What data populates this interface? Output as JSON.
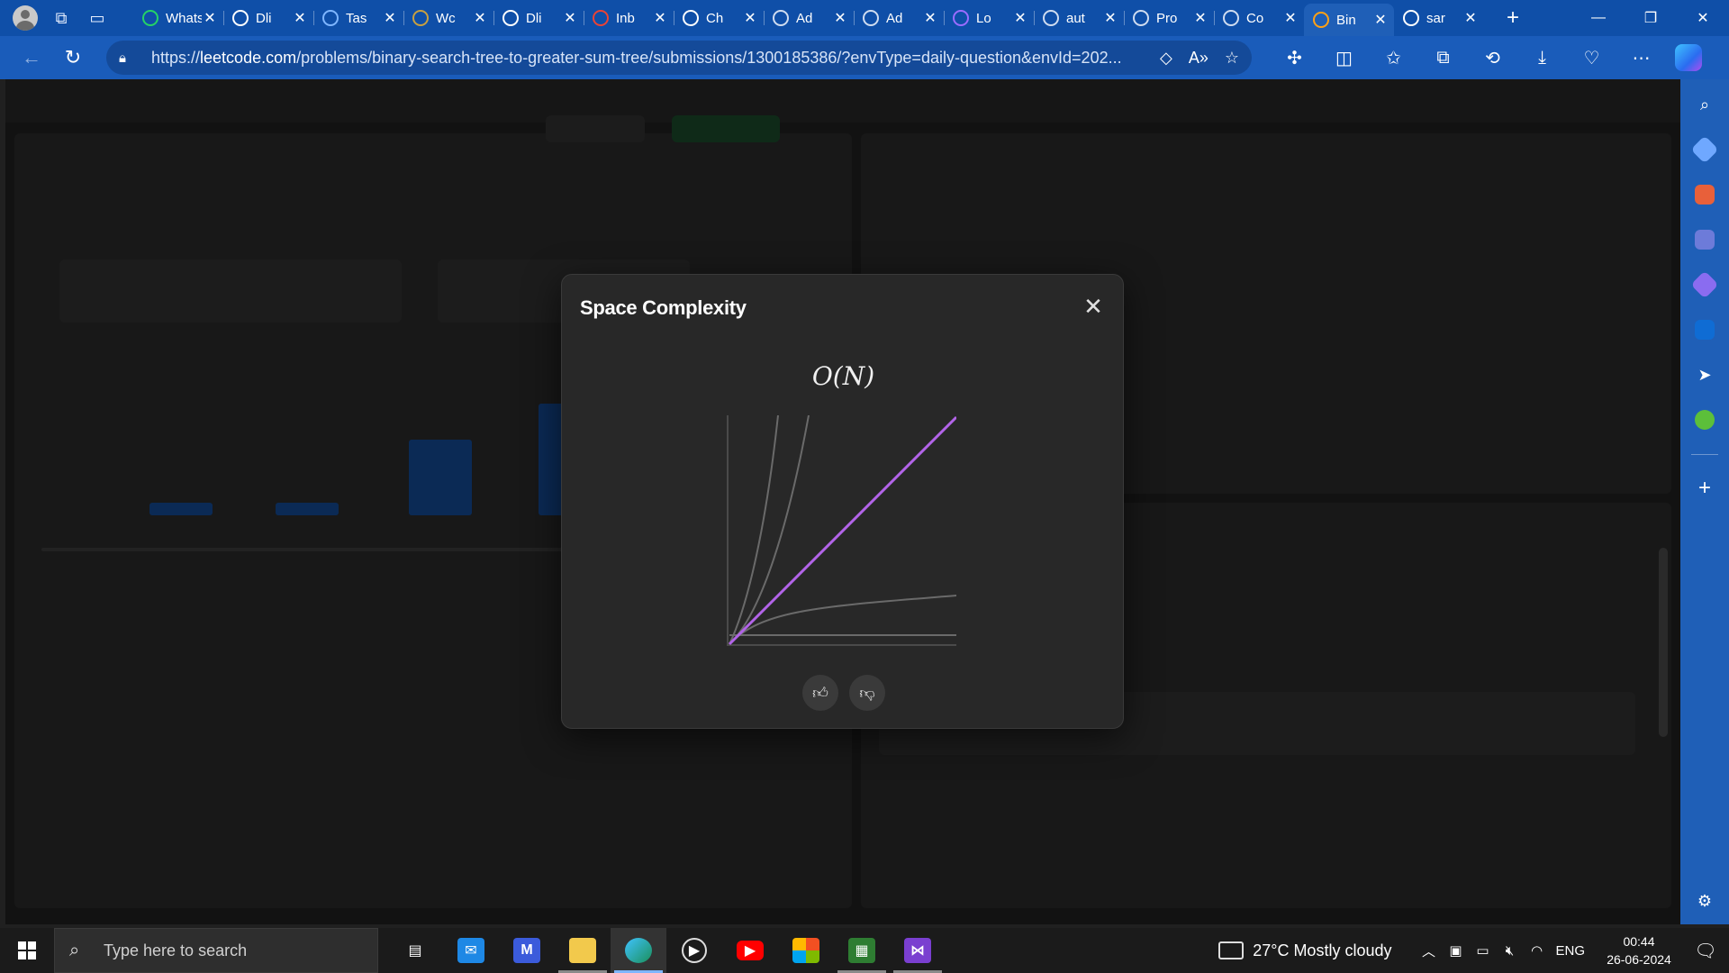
{
  "browser": {
    "tabs": [
      {
        "title": "WhatsApp",
        "icon": "whatsapp-icon",
        "color": "#25d366"
      },
      {
        "title": "Dli",
        "icon": "github-icon",
        "color": "#ffffff"
      },
      {
        "title": "Tas",
        "icon": "link-icon",
        "color": "#7fb6ff"
      },
      {
        "title": "Wc",
        "icon": "w-app-icon",
        "color": "#c8a040"
      },
      {
        "title": "Dli",
        "icon": "github-icon",
        "color": "#ffffff"
      },
      {
        "title": "Inb",
        "icon": "gmail-icon",
        "color": "#ea4335"
      },
      {
        "title": "Ch",
        "icon": "chatgpt-icon",
        "color": "#ffffff"
      },
      {
        "title": "Ad",
        "icon": "document-icon",
        "color": "#cfdcf0"
      },
      {
        "title": "Ad",
        "icon": "sk-icon",
        "color": "#cfdcf0"
      },
      {
        "title": "Lo",
        "icon": "bar-logo-icon",
        "color": "#9b6cff"
      },
      {
        "title": "aut",
        "icon": "document-icon",
        "color": "#cfdcf0"
      },
      {
        "title": "Pro",
        "icon": "leetcode-icon",
        "color": "#cfdcf0"
      },
      {
        "title": "Co",
        "icon": "leetcode-icon",
        "color": "#cfdcf0"
      },
      {
        "title": "Bin",
        "icon": "leetcode-icon",
        "color": "#ffa116",
        "active": true
      },
      {
        "title": "sar",
        "icon": "github-icon",
        "color": "#ffffff"
      }
    ],
    "url_host": "leetcode.com",
    "url_scheme": "https://",
    "url_path": "/problems/binary-search-tree-to-greater-sum-tree/submissions/1300185386/?envType=daily-question&envId=202..."
  },
  "modal": {
    "title": "Space Complexity",
    "complexity": "O(N)",
    "like_icon": "thumbs-up-icon",
    "dislike_icon": "thumbs-down-icon",
    "highlight_color": "#b264e8"
  },
  "taskbar": {
    "search_placeholder": "Type here to search",
    "weather": "27°C  Mostly cloudy",
    "language": "ENG",
    "time": "00:44",
    "date": "26-06-2024"
  }
}
